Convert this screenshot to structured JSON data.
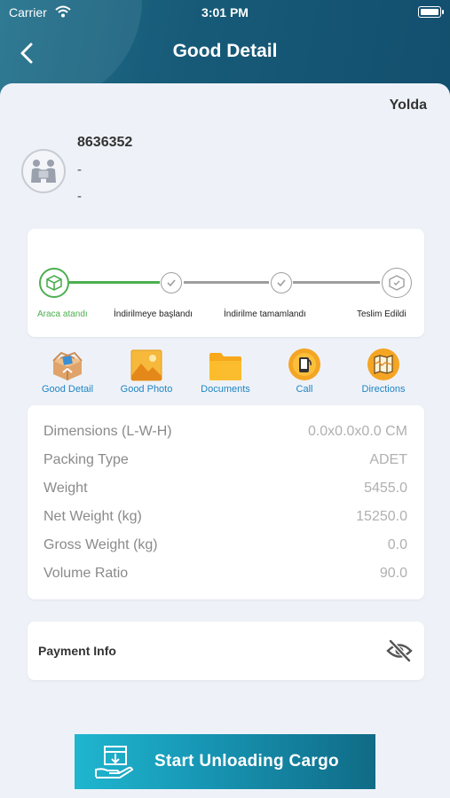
{
  "status_bar": {
    "carrier": "Carrier",
    "time": "3:01 PM"
  },
  "header": {
    "title": "Good Detail"
  },
  "shipment": {
    "status": "Yolda",
    "id": "8636352",
    "line1": "-",
    "line2": "-"
  },
  "steps": [
    {
      "label": "Araca atandı",
      "state": "active"
    },
    {
      "label": "İndirilmeye başlandı",
      "state": "pending"
    },
    {
      "label": "İndirilme tamamlandı",
      "state": "pending"
    },
    {
      "label": "Teslim Edildi",
      "state": "pending"
    }
  ],
  "actions": [
    {
      "label": "Good Detail",
      "icon": "package-icon"
    },
    {
      "label": "Good Photo",
      "icon": "photo-icon"
    },
    {
      "label": "Documents",
      "icon": "folder-icon"
    },
    {
      "label": "Call",
      "icon": "phone-icon"
    },
    {
      "label": "Directions",
      "icon": "map-icon"
    }
  ],
  "details": [
    {
      "key": "Dimensions (L-W-H)",
      "value": "0.0x0.0x0.0 CM"
    },
    {
      "key": "Packing Type",
      "value": "ADET"
    },
    {
      "key": "Weight",
      "value": "5455.0"
    },
    {
      "key": "Net Weight (kg)",
      "value": "15250.0"
    },
    {
      "key": "Gross Weight (kg)",
      "value": "0.0"
    },
    {
      "key": "Volume Ratio",
      "value": "90.0"
    }
  ],
  "payment": {
    "label": "Payment Info",
    "icon": "eye-off-icon"
  },
  "primary_button": {
    "label": "Start Unloading Cargo"
  },
  "colors": {
    "accent_green": "#4caf50",
    "link_blue": "#1f84c3",
    "header_teal": "#175b79"
  }
}
